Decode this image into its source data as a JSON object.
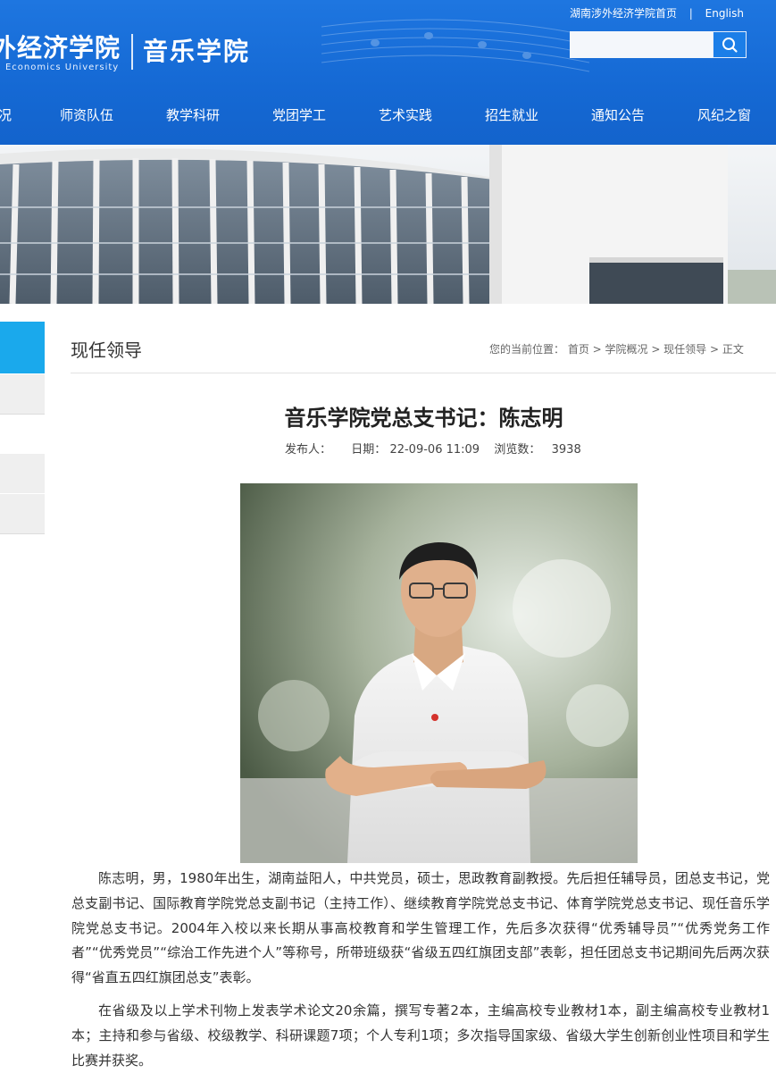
{
  "header": {
    "logo_cn": "外经济学院",
    "logo_en": "l Economics University",
    "logo_sub": "音乐学院",
    "top_links": {
      "home": "湖南涉外经济学院首页",
      "separator": "|",
      "english": "English"
    },
    "search": {
      "placeholder": ""
    },
    "nav": [
      "况",
      "师资队伍",
      "教学科研",
      "党团学工",
      "艺术实践",
      "招生就业",
      "通知公告",
      "风纪之窗"
    ]
  },
  "section": {
    "title": "现任领导",
    "breadcrumb": "您的当前位置： 首页 > 学院概况 > 现任领导 > 正文"
  },
  "article": {
    "title": "音乐学院党总支书记：陈志明",
    "publisher_label": "发布人：",
    "date_label": "日期：",
    "date": "22-09-06 11:09",
    "views_label": "浏览数：",
    "views": "3938",
    "paragraphs": [
      "陈志明，男，1980年出生，湖南益阳人，中共党员，硕士，思政教育副教授。先后担任辅导员，团总支书记，党总支副书记、国际教育学院党总支副书记（主持工作）、继续教育学院党总支书记、体育学院党总支书记、现任音乐学院党总支书记。2004年入校以来长期从事高校教育和学生管理工作，先后多次获得“优秀辅导员”“优秀党务工作者”“优秀党员”“综治工作先进个人”等称号，所带班级获“省级五四红旗团支部”表彰，担任团总支书记期间先后两次获得“省直五四红旗团总支”表彰。",
      "在省级及以上学术刊物上发表学术论文20余篇，撰写专著2本，主编高校专业教材1本，副主编高校专业教材1本；主持和参与省级、校级教学、科研课题7项；个人专利1项；多次指导国家级、省级大学生创新创业性项目和学生比赛并获奖。"
    ]
  },
  "colors": {
    "header_blue": "#1569d4",
    "sidebar_active": "#1aa9ec",
    "sidebar_inactive": "#efefef"
  }
}
